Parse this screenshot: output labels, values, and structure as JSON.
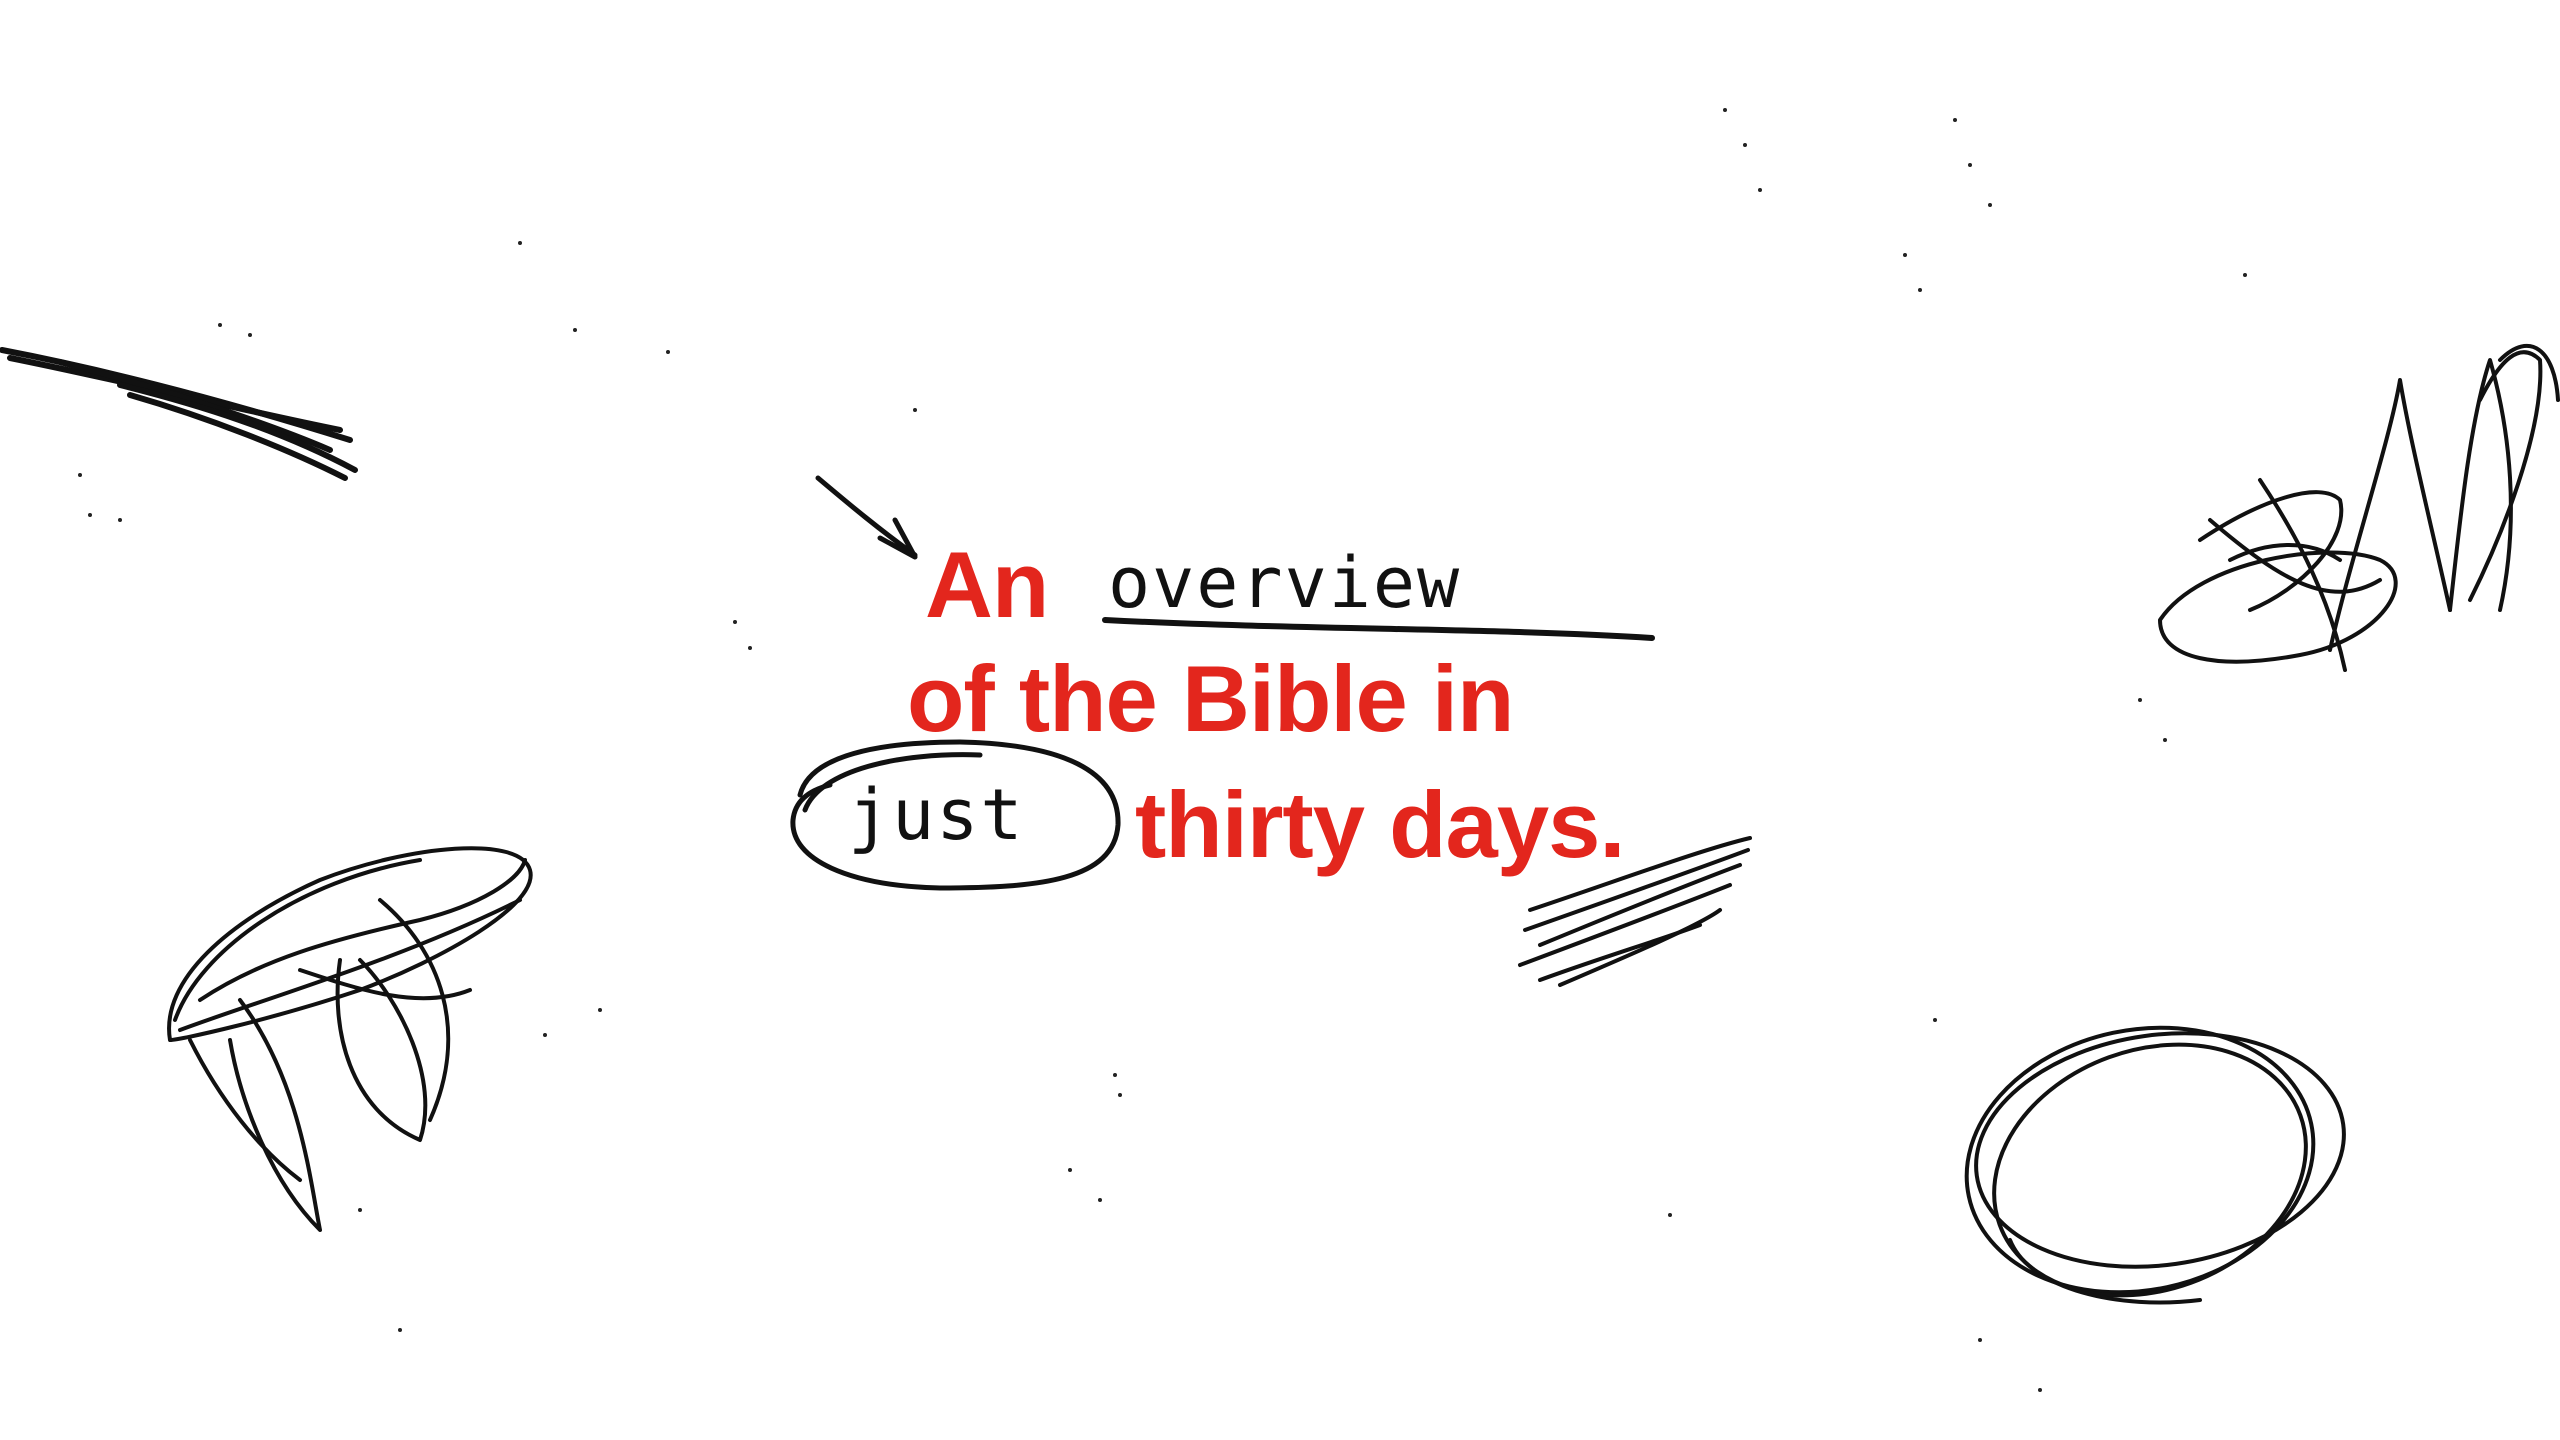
{
  "headline": {
    "line1_prefix": "An",
    "line1_handwritten": "overview",
    "line2": "of the Bible in",
    "line3_handwritten": "just",
    "line3_suffix": "thirty days."
  },
  "colors": {
    "accent": "#e3261d",
    "ink": "#111111",
    "background": "#ffffff"
  },
  "icons": [
    "arrow-icon",
    "underline-stroke",
    "circle-stroke",
    "scribble"
  ]
}
